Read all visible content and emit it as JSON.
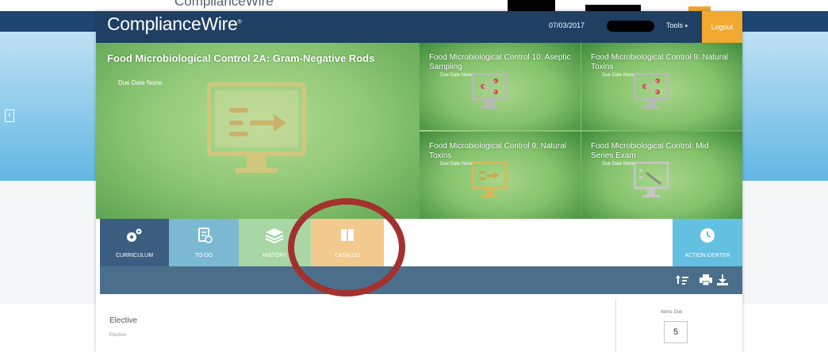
{
  "background": {
    "ghost_title": "ComplianceWire",
    "ghost_mark": "®"
  },
  "header": {
    "logo": "ComplianceWire",
    "logo_mark": "®",
    "date": "07/03/2017",
    "tools_label": "Tools",
    "logout_label": "Logout"
  },
  "hero": {
    "main": {
      "title": "Food Microbiological Control 2A: Gram-Negative Rods",
      "due": "Due Date  None",
      "icon": "presentation-icon"
    },
    "tiles": [
      {
        "title": "Food Microbiological Control 10: Aseptic Sampling",
        "due": "Due Date  None",
        "icon": "share-icon"
      },
      {
        "title": "Food Microbiological Control 9: Natural Toxins",
        "due": "Due Date  None",
        "icon": "share-icon"
      },
      {
        "title": "Food Microbiological Control 9: Natural Toxins",
        "due": "Due Date  None",
        "icon": "presentation-icon"
      },
      {
        "title": "Food Microbiological Control: Mid Series Exam",
        "due": "Due Date  None",
        "icon": "exam-icon"
      }
    ]
  },
  "tabs": {
    "curriculum": "CURRICULUM",
    "todo": "TO-DO",
    "history": "HISTORY",
    "catalog": "CATALOG",
    "action_center": "ACTION CENTER"
  },
  "content": {
    "elective_title": "Elective",
    "elective_sub": "Elective",
    "items_due_label": "Items Due",
    "items_due_value": "5"
  },
  "colors": {
    "header": "#1f3f63",
    "logout": "#f0a830",
    "tab_curriculum": "#3b5e80",
    "tab_todo": "#7bb8d2",
    "tab_history": "#a8d7a6",
    "tab_catalog": "#f2c98f",
    "tab_action": "#64c0e0",
    "annotation": "#a3312e"
  }
}
